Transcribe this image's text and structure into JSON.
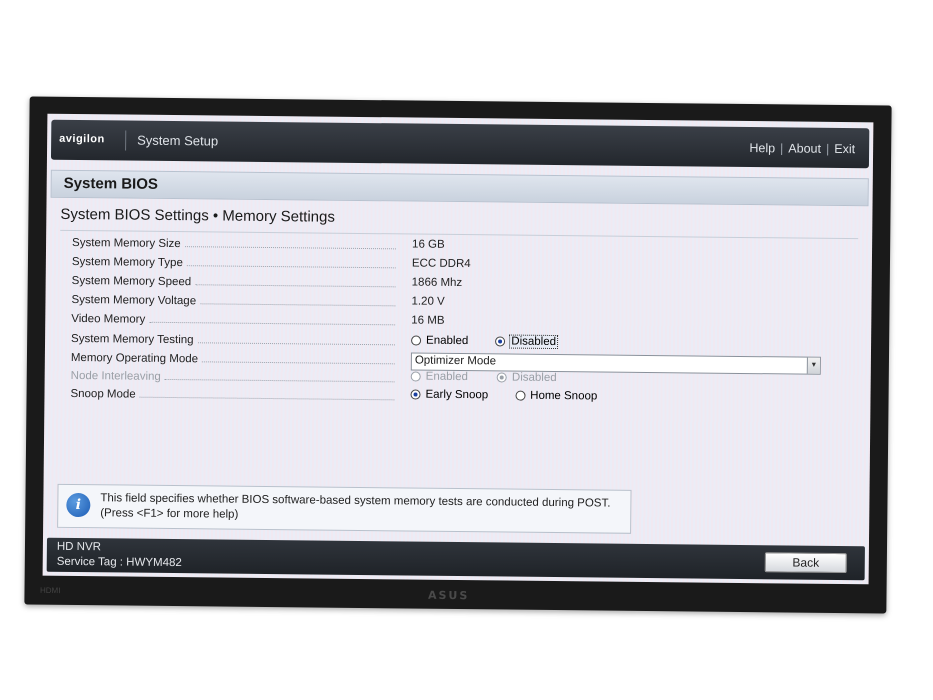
{
  "header": {
    "brand": "avigilon",
    "app_title": "System Setup",
    "links": {
      "help": "Help",
      "about": "About",
      "exit": "Exit",
      "separator": "|"
    }
  },
  "section": {
    "title": "System BIOS"
  },
  "page": {
    "title": "System BIOS Settings • Memory Settings"
  },
  "settings": {
    "memory_size": {
      "label": "System Memory Size",
      "value": "16 GB"
    },
    "memory_type": {
      "label": "System Memory Type",
      "value": "ECC DDR4"
    },
    "memory_speed": {
      "label": "System Memory Speed",
      "value": "1866 Mhz"
    },
    "memory_voltage": {
      "label": "System Memory Voltage",
      "value": "1.20 V"
    },
    "video_memory": {
      "label": "Video Memory",
      "value": "16 MB"
    },
    "memory_testing": {
      "label": "System Memory Testing",
      "options": [
        "Enabled",
        "Disabled"
      ],
      "selected": "Disabled"
    },
    "operating_mode": {
      "label": "Memory Operating Mode",
      "selected": "Optimizer Mode"
    },
    "node_interleaving": {
      "label": "Node Interleaving",
      "options": [
        "Enabled",
        "Disabled"
      ],
      "selected": "Disabled",
      "disabled": true
    },
    "snoop_mode": {
      "label": "Snoop Mode",
      "options": [
        "Early Snoop",
        "Home Snoop"
      ],
      "selected": "Early Snoop"
    }
  },
  "help": {
    "icon": "info-icon",
    "text": "This field specifies whether BIOS software-based system memory tests are conducted during POST. (Press <F1> for more help)"
  },
  "footer": {
    "system_name": "HD NVR",
    "service_tag": "Service Tag : HWYM482",
    "back_label": "Back"
  },
  "monitor": {
    "brand": "ASUS",
    "port_label": "HDMI"
  },
  "colors": {
    "header_bg": "#2b3036",
    "screen_bg": "#eef0f6",
    "section_bg": "#d3dbe6",
    "radio_selected": "#1b3fa0"
  }
}
